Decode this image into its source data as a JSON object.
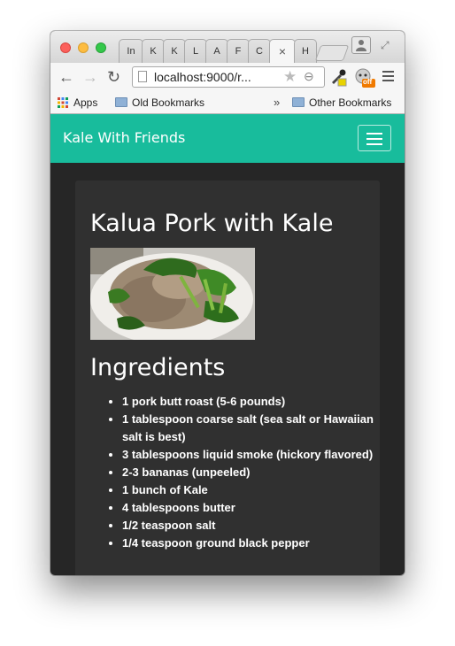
{
  "browser": {
    "tabs": [
      "In",
      "K",
      "K",
      "L",
      "A",
      "F",
      "C",
      "",
      "H"
    ],
    "active_tab_close": "×",
    "address": "localhost:9000/r...",
    "bookmarks": {
      "apps": "Apps",
      "old": "Old Bookmarks",
      "overflow": "»",
      "other": "Other Bookmarks"
    },
    "extension_badge": "off"
  },
  "site": {
    "brand": "Kale With Friends",
    "accent_color": "#18bc9c"
  },
  "recipe": {
    "title": "Kalua Pork with Kale",
    "image_alt": "kale-and-pork-plate",
    "ingredients_heading": "Ingredients",
    "ingredients": [
      "1 pork butt roast (5-6 pounds)",
      "1 tablespoon coarse salt (sea salt or Hawaiian salt is best)",
      "3 tablespoons liquid smoke (hickory flavored)",
      "2-3 bananas (unpeeled)",
      "1 bunch of Kale",
      "4 tablespoons butter",
      "1/2 teaspoon salt",
      "1/4 teaspoon ground black pepper"
    ]
  }
}
